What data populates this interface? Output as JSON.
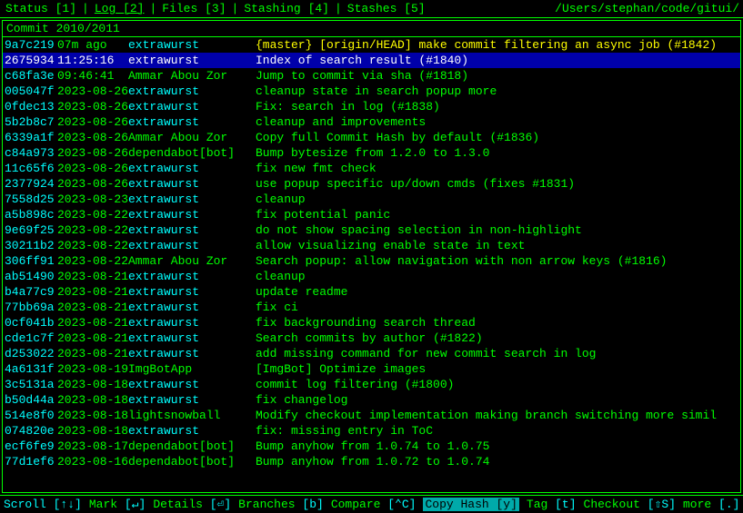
{
  "nav": {
    "items": [
      {
        "label": "Status",
        "badge": "[1]"
      },
      {
        "label": "Log",
        "badge": "[2]"
      },
      {
        "label": "Files",
        "badge": "[3]"
      },
      {
        "label": "Stashing",
        "badge": "[4]"
      },
      {
        "label": "Stashes",
        "badge": "[5]"
      }
    ],
    "path": "/Users/stephan/code/gitui/"
  },
  "section": {
    "header": "Commit 2010/2011"
  },
  "commits": [
    {
      "hash": "9a7c219",
      "time": "07m ago",
      "author": "extrawurst",
      "author_color": "cyan",
      "message": "{master} [origin/HEAD] make commit filtering an async job (#1842)",
      "message_color": "yellow",
      "selected": false
    },
    {
      "hash": "2675934",
      "time": "11:25:16",
      "author": "extrawurst",
      "author_color": "cyan",
      "message": "Index of search result (#1840)",
      "message_color": "white",
      "selected": true
    },
    {
      "hash": "c68fa3e",
      "time": "09:46:41",
      "author": "Ammar Abou Zor",
      "author_color": "green",
      "message": "Jump to commit via sha (#1818)",
      "message_color": "green",
      "selected": false
    },
    {
      "hash": "005047f",
      "time": "2023-08-26",
      "author": "extrawurst",
      "author_color": "cyan",
      "message": "cleanup state in search popup more",
      "message_color": "green",
      "selected": false
    },
    {
      "hash": "0fdec13",
      "time": "2023-08-26",
      "author": "extrawurst",
      "author_color": "cyan",
      "message": "Fix: search in log (#1838)",
      "message_color": "green",
      "selected": false
    },
    {
      "hash": "5b2b8c7",
      "time": "2023-08-26",
      "author": "extrawurst",
      "author_color": "cyan",
      "message": "cleanup and improvements",
      "message_color": "green",
      "selected": false
    },
    {
      "hash": "6339a1f",
      "time": "2023-08-26",
      "author": "Ammar Abou Zor",
      "author_color": "green",
      "message": "Copy full Commit Hash by default (#1836)",
      "message_color": "green",
      "selected": false
    },
    {
      "hash": "c84a973",
      "time": "2023-08-26",
      "author": "dependabot[bot]",
      "author_color": "green",
      "message": "Bump bytesize from 1.2.0 to 1.3.0",
      "message_color": "green",
      "selected": false
    },
    {
      "hash": "11c65f6",
      "time": "2023-08-26",
      "author": "extrawurst",
      "author_color": "cyan",
      "message": "fix new fmt check",
      "message_color": "green",
      "selected": false
    },
    {
      "hash": "2377924",
      "time": "2023-08-26",
      "author": "extrawurst",
      "author_color": "cyan",
      "message": "use popup specific up/down cmds (fixes #1831)",
      "message_color": "green",
      "selected": false
    },
    {
      "hash": "7558d25",
      "time": "2023-08-23",
      "author": "extrawurst",
      "author_color": "cyan",
      "message": "cleanup",
      "message_color": "green",
      "selected": false
    },
    {
      "hash": "a5b898c",
      "time": "2023-08-22",
      "author": "extrawurst",
      "author_color": "cyan",
      "message": "fix potential panic",
      "message_color": "green",
      "selected": false
    },
    {
      "hash": "9e69f25",
      "time": "2023-08-22",
      "author": "extrawurst",
      "author_color": "cyan",
      "message": "do not show spacing selection in non-highlight",
      "message_color": "green",
      "selected": false
    },
    {
      "hash": "30211b2",
      "time": "2023-08-22",
      "author": "extrawurst",
      "author_color": "cyan",
      "message": "allow visualizing enable state in text",
      "message_color": "green",
      "selected": false
    },
    {
      "hash": "306ff91",
      "time": "2023-08-22",
      "author": "Ammar Abou Zor",
      "author_color": "green",
      "message": "Search popup: allow navigation with non arrow keys (#1816)",
      "message_color": "green",
      "selected": false
    },
    {
      "hash": "ab51490",
      "time": "2023-08-21",
      "author": "extrawurst",
      "author_color": "cyan",
      "message": "cleanup",
      "message_color": "green",
      "selected": false
    },
    {
      "hash": "b4a77c9",
      "time": "2023-08-21",
      "author": "extrawurst",
      "author_color": "cyan",
      "message": "update readme",
      "message_color": "green",
      "selected": false
    },
    {
      "hash": "77bb69a",
      "time": "2023-08-21",
      "author": "extrawurst",
      "author_color": "cyan",
      "message": "fix ci",
      "message_color": "green",
      "selected": false
    },
    {
      "hash": "0cf041b",
      "time": "2023-08-21",
      "author": "extrawurst",
      "author_color": "cyan",
      "message": "fix backgrounding search thread",
      "message_color": "green",
      "selected": false
    },
    {
      "hash": "cde1c7f",
      "time": "2023-08-21",
      "author": "extrawurst",
      "author_color": "cyan",
      "message": "Search commits by author (#1822)",
      "message_color": "green",
      "selected": false
    },
    {
      "hash": "d253022",
      "time": "2023-08-21",
      "author": "extrawurst",
      "author_color": "cyan",
      "message": "add missing command for new commit search in log",
      "message_color": "green",
      "selected": false
    },
    {
      "hash": "4a6131f",
      "time": "2023-08-19",
      "author": "ImgBotApp",
      "author_color": "green",
      "message": "[ImgBot] Optimize images",
      "message_color": "green",
      "selected": false
    },
    {
      "hash": "3c5131a",
      "time": "2023-08-18",
      "author": "extrawurst",
      "author_color": "cyan",
      "message": "commit log filtering (#1800)",
      "message_color": "green",
      "selected": false
    },
    {
      "hash": "b50d44a",
      "time": "2023-08-18",
      "author": "extrawurst",
      "author_color": "cyan",
      "message": "fix changelog",
      "message_color": "green",
      "selected": false
    },
    {
      "hash": "514e8f0",
      "time": "2023-08-18",
      "author": "lightsnowball",
      "author_color": "green",
      "message": "Modify checkout implementation making branch switching more simil",
      "message_color": "green",
      "selected": false
    },
    {
      "hash": "074820e",
      "time": "2023-08-18",
      "author": "extrawurst",
      "author_color": "cyan",
      "message": "fix: missing entry in ToC",
      "message_color": "green",
      "selected": false
    },
    {
      "hash": "ecf6fe9",
      "time": "2023-08-17",
      "author": "dependabot[bot]",
      "author_color": "green",
      "message": "Bump anyhow from 1.0.74 to 1.0.75",
      "message_color": "green",
      "selected": false
    },
    {
      "hash": "77d1ef6",
      "time": "2023-08-16",
      "author": "dependabot[bot]",
      "author_color": "green",
      "message": "Bump anyhow from 1.0.72 to 1.0.74",
      "message_color": "green",
      "selected": false
    }
  ],
  "bottom_bar": {
    "scroll_label": "Scroll",
    "scroll_keys": "[↑↓]",
    "mark_label": "Mark",
    "mark_key": "[↵]",
    "details_label": "Details",
    "details_key": "[⏎]",
    "branches_label": "Branches",
    "branches_key": "[b]",
    "compare_label": "Compare",
    "compare_key": "[⌃C]",
    "copy_hash_label": "Copy Hash",
    "copy_hash_key": "[y]",
    "tag_label": "Tag",
    "tag_key": "[t]",
    "checkout_label": "Checkout",
    "checkout_key": "[⇧S]",
    "more_label": "more",
    "more_key": "[.]"
  }
}
